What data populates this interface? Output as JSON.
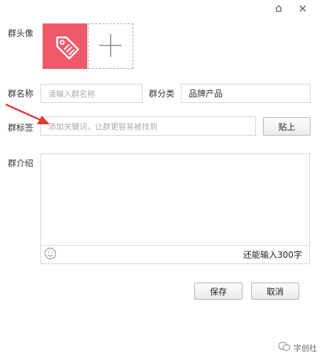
{
  "window": {
    "skin_icon": "skin-icon",
    "close_icon": "close-icon"
  },
  "avatar": {
    "label": "群头像",
    "icon": "tag-icon",
    "accent": "#ee5a6a",
    "add_icon": "plus-icon"
  },
  "name": {
    "label": "群名称",
    "placeholder": "请输入群名称"
  },
  "category": {
    "label": "群分类",
    "value": "品牌产品"
  },
  "tags": {
    "label": "群标签",
    "placeholder": "添加关键词，让群更容易被找到",
    "button": "贴上"
  },
  "intro": {
    "label": "群介绍",
    "counter": "还能输入300字",
    "emoji_icon": "emoji-icon"
  },
  "actions": {
    "save": "保存",
    "cancel": "取消"
  },
  "watermark": {
    "text": "字创社",
    "icon": "wechat-icon"
  },
  "annotation": {
    "arrow_color": "#e53935"
  }
}
